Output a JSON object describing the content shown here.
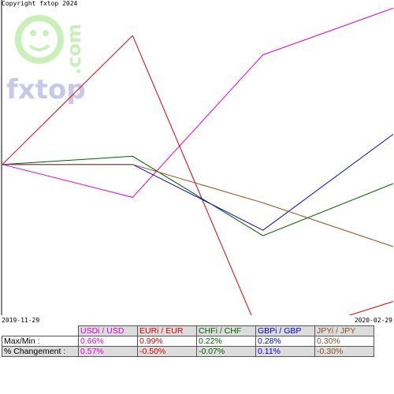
{
  "copyright": "Copyright fxtop 2024",
  "watermark": {
    "brand": "fxtop",
    "tld": ".com",
    "color": "#c8f0b8",
    "brand_color": "#c8c8e8"
  },
  "chart_data": {
    "type": "line",
    "x": [
      "2019-11-29",
      "2019-12-31",
      "2020-01-31",
      "2020-02-29"
    ],
    "x_start_label": "2019-11-29",
    "x_end_label": "2020-02-29",
    "ylim": [
      -0.55,
      0.6
    ],
    "y_unit": "%",
    "grid": false,
    "series": [
      {
        "name": "USDi / USD",
        "color": "#e000e0",
        "values": [
          0,
          -0.12,
          0.4,
          0.57
        ]
      },
      {
        "name": "EURi / EUR",
        "color": "#e00000",
        "values": [
          0,
          0.47,
          -0.65,
          -0.5
        ]
      },
      {
        "name": "CHFi / CHF",
        "color": "#006000",
        "values": [
          0,
          0.03,
          -0.26,
          -0.07
        ]
      },
      {
        "name": "GBPi / GBP",
        "color": "#0000e0",
        "values": [
          0,
          0,
          -0.24,
          0.11
        ]
      },
      {
        "name": "JPYi / JPY",
        "color": "#905020",
        "values": [
          0,
          0,
          -0.14,
          -0.3
        ]
      }
    ]
  },
  "table": {
    "columns": [
      {
        "name": "USDi / USD",
        "color": "#e000e0"
      },
      {
        "name": "EURi / EUR",
        "color": "#e00000"
      },
      {
        "name": "CHFi / CHF",
        "color": "#006000"
      },
      {
        "name": "GBPi / GBP",
        "color": "#0000e0"
      },
      {
        "name": "JPYi / JPY",
        "color": "#905020"
      }
    ],
    "rows": [
      {
        "label": "Max/Min :",
        "values": [
          "0.66%",
          "0.99%",
          "0.22%",
          "0.28%",
          "0.30%"
        ]
      },
      {
        "label": "% Changement :",
        "values": [
          "0.57%",
          "-0.50%",
          "-0.07%",
          "0.11%",
          "-0.30%"
        ]
      }
    ]
  }
}
